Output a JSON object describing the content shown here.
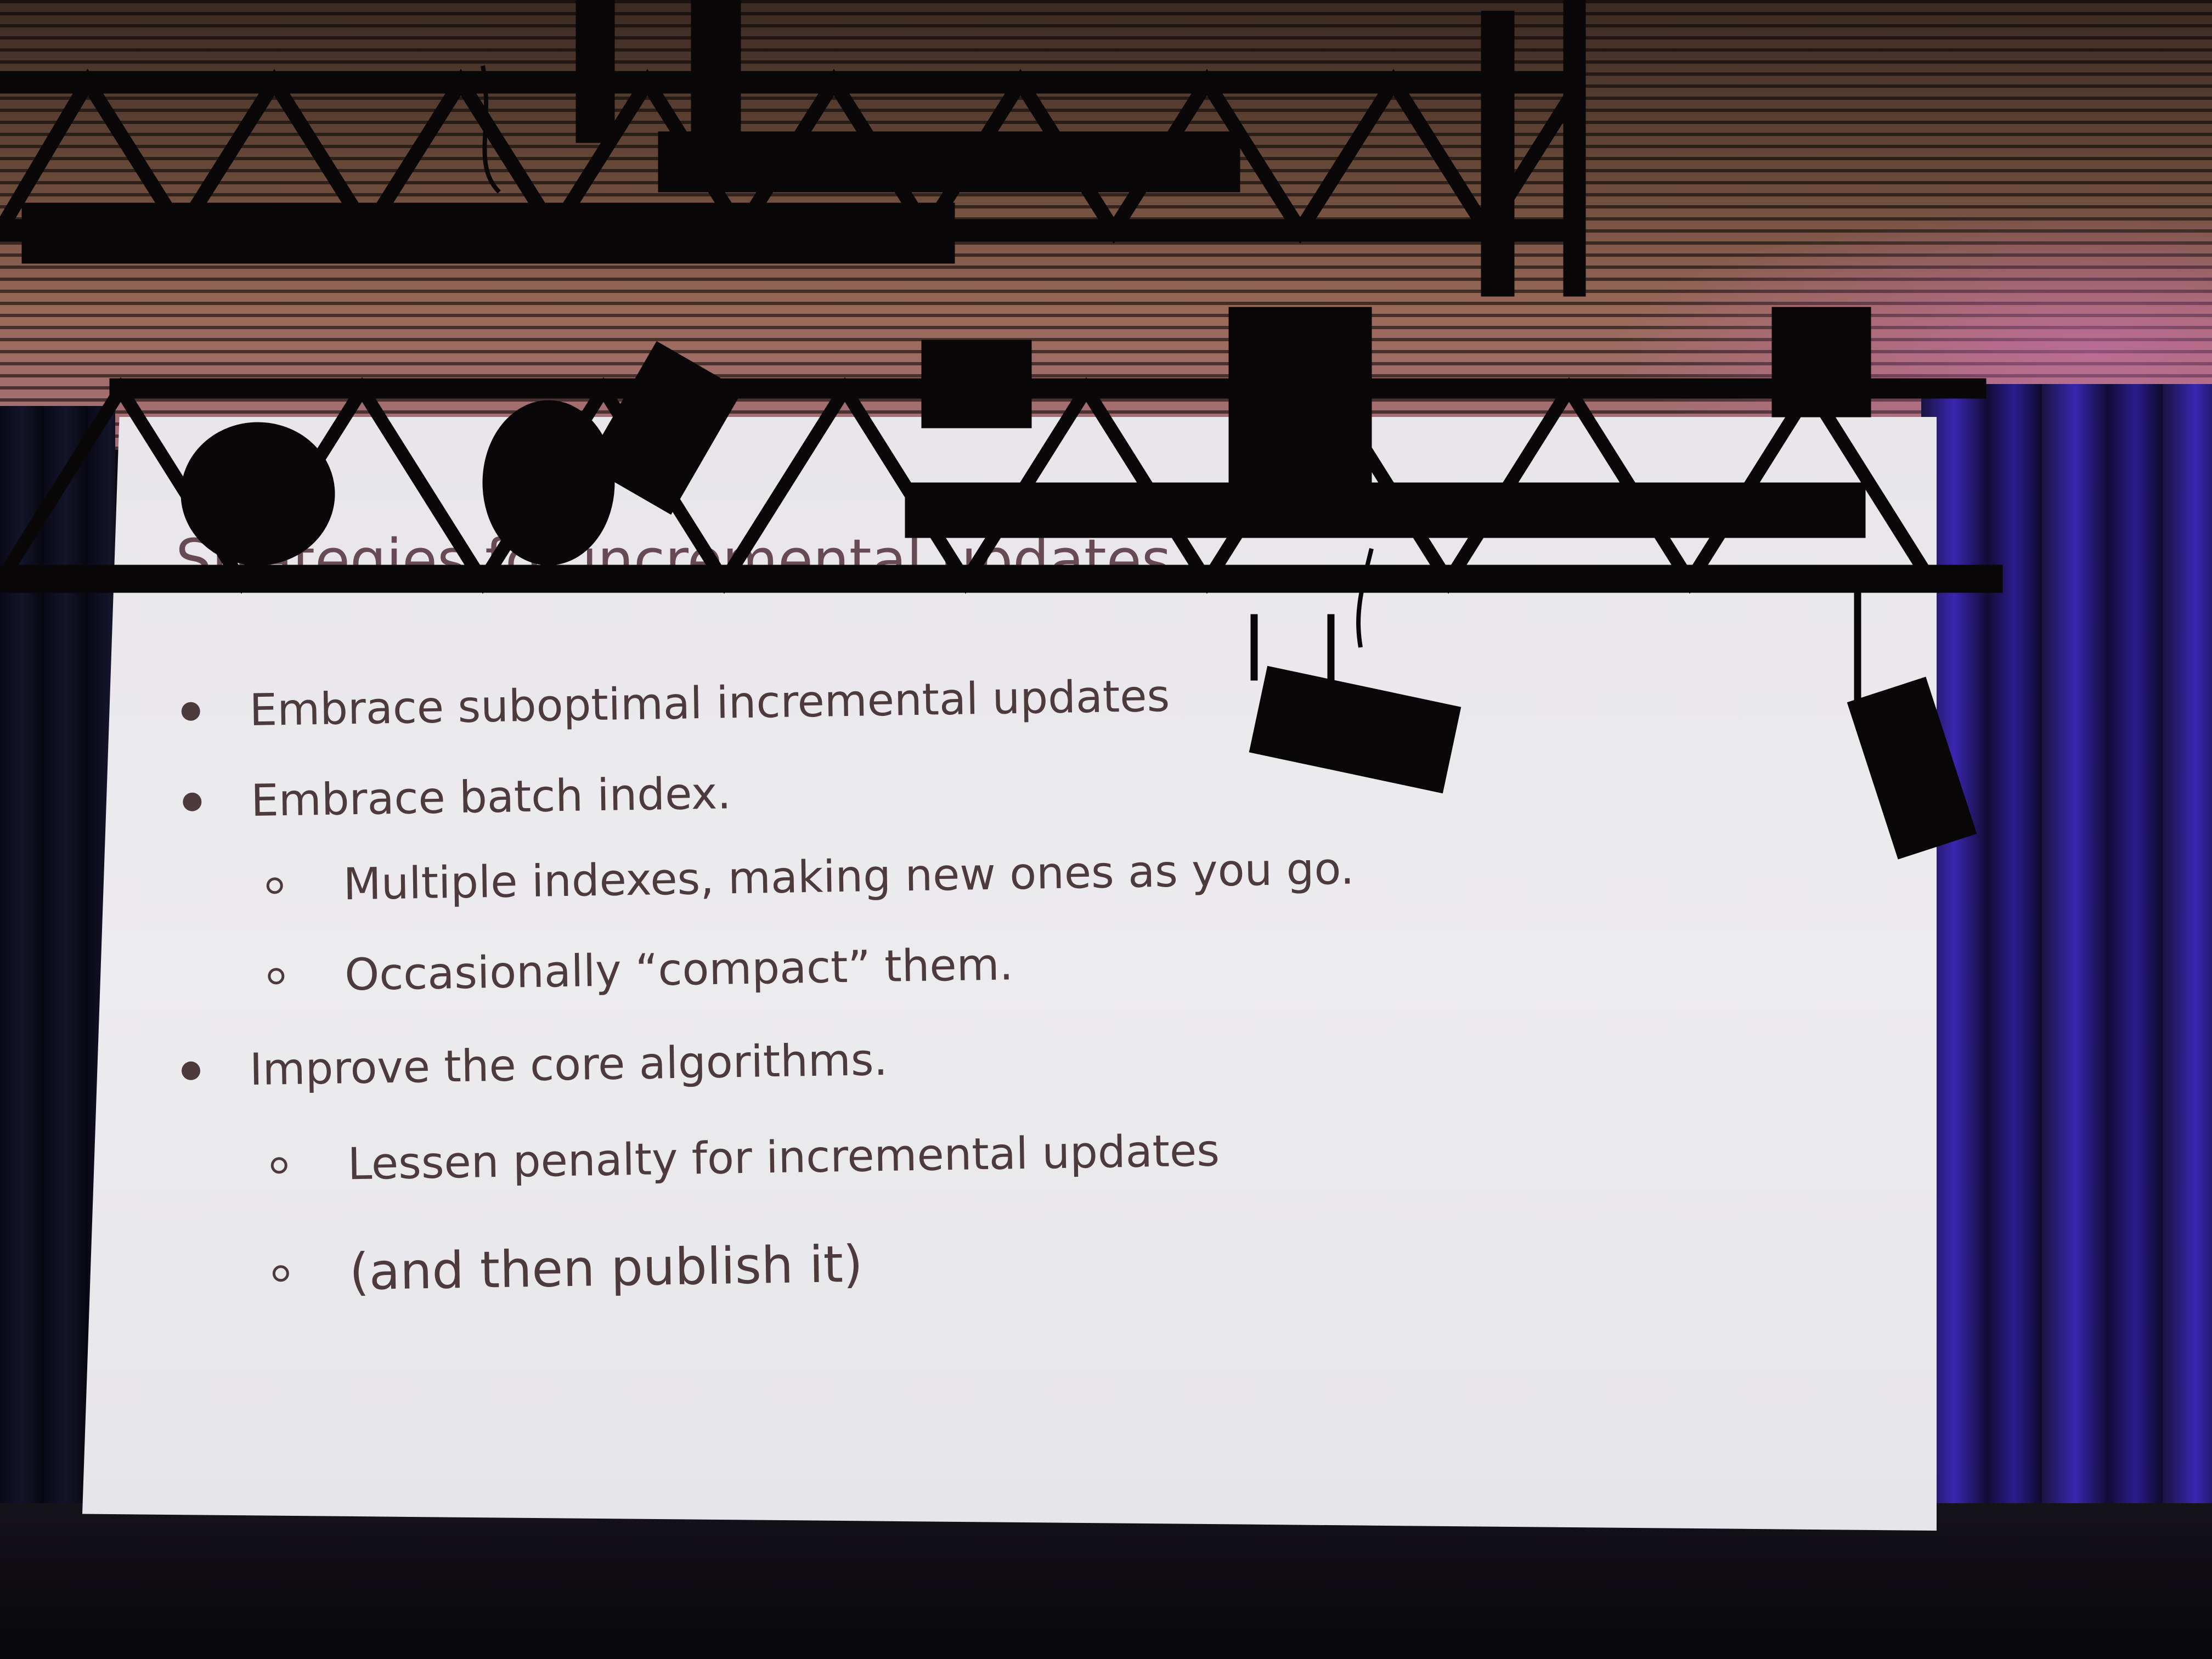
{
  "slide": {
    "title": "Strategies for incremental updates",
    "bullets": [
      {
        "level": 1,
        "text": "Embrace suboptimal incremental updates"
      },
      {
        "level": 1,
        "text": "Embrace batch index."
      },
      {
        "level": 2,
        "text": "Multiple indexes, making new ones as you go."
      },
      {
        "level": 2,
        "text": "Occasionally “compact” them."
      },
      {
        "level": 1,
        "text": "Improve the core algorithms."
      },
      {
        "level": 2,
        "text": "Lessen penalty for incremental updates"
      },
      {
        "level": 2,
        "text": "(and then publish it)"
      }
    ]
  },
  "colors": {
    "slide_text": "#4d3a3c",
    "slide_background": "#eae9ec",
    "curtain_right": "#3a26b0",
    "truss": "#0a0708"
  }
}
